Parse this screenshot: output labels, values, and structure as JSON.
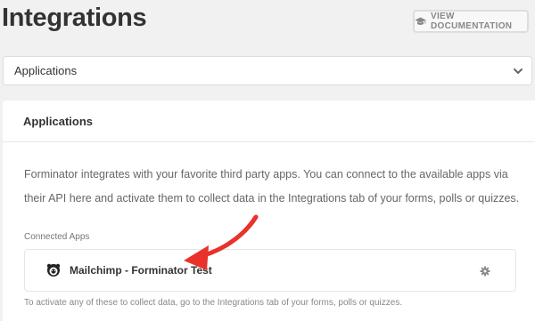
{
  "header": {
    "title": "Integrations",
    "doc_button_label": "VIEW DOCUMENTATION",
    "doc_button_icon": "graduation-cap-icon"
  },
  "section_select": {
    "value": "Applications"
  },
  "card": {
    "title": "Applications",
    "description": "Forminator integrates with your favorite third party apps. You can connect to the available apps via their API here and activate them to collect data in the Integrations tab of your forms, polls or quizzes.",
    "connected_label": "Connected Apps",
    "apps": [
      {
        "name": "Mailchimp - Forminator Test",
        "icon": "mailchimp-icon"
      }
    ],
    "hint": "To activate any of these to collect data, go to the Integrations tab of your forms, polls or quizzes."
  },
  "colors": {
    "background": "#f1f1f1",
    "card": "#ffffff",
    "annotation_arrow": "#e8322b"
  }
}
